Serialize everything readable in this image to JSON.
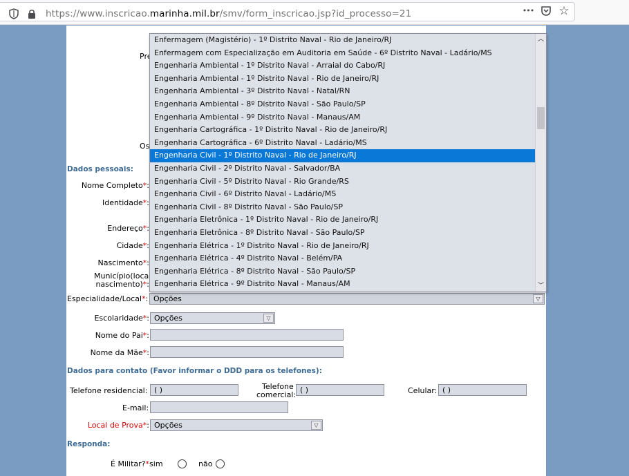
{
  "browser": {
    "url_prefix": "https://www.inscricao.",
    "url_domain": "marinha.mil.br",
    "url_path": "/smv/form_inscricao.jsp?id_processo=21",
    "icons": [
      "shield-icon",
      "lock-icon",
      "more-icon",
      "pocket-icon",
      "bookmark-star-icon"
    ],
    "more_glyph": "•••",
    "star_glyph": "☆"
  },
  "form": {
    "partial_label_top": "Pre",
    "partial_label_obs": "Os",
    "dados_pessoais": "Dados pessoais:",
    "nome_completo": "Nome Completo",
    "identidade": "Identidade",
    "endereco": "Endereço",
    "cidade": "Cidade",
    "nascimento": "Nascimento",
    "municipio_1": "Município(local",
    "municipio_2": "nascimento)",
    "especialidade": "Especialidade/Local",
    "especialidade_value": "Opções",
    "escolaridade": "Escolaridade",
    "escolaridade_value": "Opções",
    "nome_pai": "Nome do Pai",
    "nome_mae": "Nome da Mãe",
    "dados_contato": "Dados para contato (Favor informar o DDD para os telefones):",
    "tel_residencial": "Telefone residencial:",
    "tel_residencial_value": "( )",
    "tel_comercial_1": "Telefone",
    "tel_comercial_2": "comercial:",
    "tel_comercial_value": "( )",
    "celular": "Celular:",
    "celular_value": "( )",
    "email": "E-mail:",
    "local_prova": "Local de Prova",
    "local_prova_value": "Opções",
    "responda": "Responda:",
    "militar": "É Militar?",
    "sim": "sim",
    "nao": "não",
    "required_mark": "*",
    "colon": ":"
  },
  "dropdown": {
    "options": [
      "Enfermagem (Magistério) - 1º Distrito Naval - Rio de Janeiro/RJ",
      "Enfermagem com Especialização em Auditoria em Saúde - 6º Distrito Naval - Ladário/MS",
      "Engenharia Ambiental - 1º Distrito Naval - Arraial do Cabo/RJ",
      "Engenharia Ambiental - 1º Distrito Naval - Rio de Janeiro/RJ",
      "Engenharia Ambiental - 3º Distrito Naval - Natal/RN",
      "Engenharia Ambiental - 8º Distrito Naval - São Paulo/SP",
      "Engenharia Ambiental - 9º Distrito Naval - Manaus/AM",
      "Engenharia Cartográfica - 1º Distrito Naval - Rio de Janeiro/RJ",
      "Engenharia Cartográfica - 6º Distrito Naval - Ladário/MS",
      "Engenharia Civil - 1º Distrito Naval - Rio de Janeiro/RJ",
      "Engenharia Civil - 2º Distrito Naval - Salvador/BA",
      "Engenharia Civil - 5º Distrito Naval - Rio Grande/RS",
      "Engenharia Civil - 6º Distrito Naval - Ladário/MS",
      "Engenharia Civil - 8º Distrito Naval - São Paulo/SP",
      "Engenharia Eletrônica - 1º Distrito Naval - Rio de Janeiro/RJ",
      "Engenharia Eletrônica - 8º Distrito Naval - São Paulo/SP",
      "Engenharia Elétrica - 1º Distrito Naval - Rio de Janeiro/RJ",
      "Engenharia Elétrica - 4º Distrito Naval - Belém/PA",
      "Engenharia Elétrica - 8º Distrito Naval - São Paulo/SP",
      "Engenharia Elétrica - 9º Distrito Naval - Manaus/AM"
    ],
    "selected_index": 9,
    "colors": {
      "highlight": "#0a78d7",
      "background": "#dde1e8"
    }
  }
}
